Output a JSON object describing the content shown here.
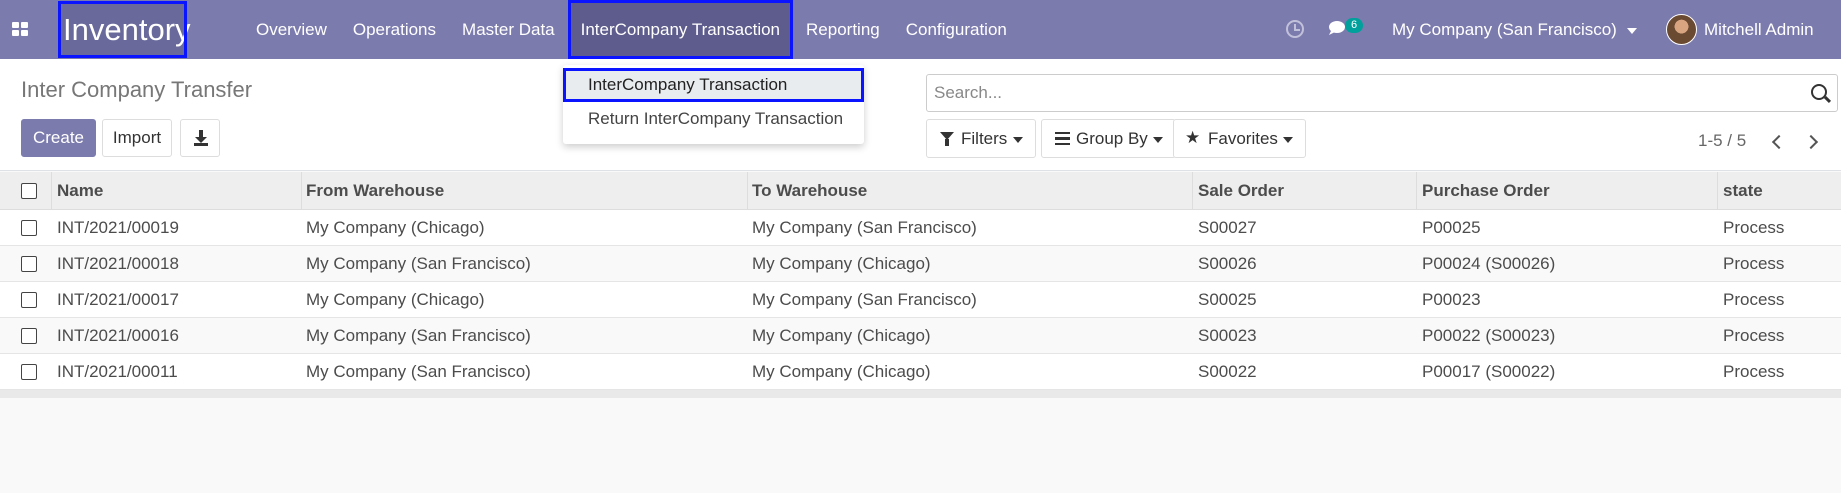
{
  "navbar": {
    "app_title": "Inventory",
    "menu": [
      "Overview",
      "Operations",
      "Master Data",
      "InterCompany Transaction",
      "Reporting",
      "Configuration"
    ],
    "messages_count": "6",
    "company": "My Company (San Francisco)",
    "user": "Mitchell Admin"
  },
  "control": {
    "breadcrumb": "Inter Company Transfer",
    "create_label": "Create",
    "import_label": "Import",
    "search_placeholder": "Search...",
    "filters_label": "Filters",
    "groupby_label": "Group By",
    "favorites_label": "Favorites",
    "pager": "1-5 / 5"
  },
  "dropdown": {
    "items": [
      "InterCompany Transaction",
      "Return InterCompany Transaction"
    ]
  },
  "table": {
    "columns": [
      "Name",
      "From Warehouse",
      "To Warehouse",
      "Sale Order",
      "Purchase Order",
      "state"
    ],
    "rows": [
      [
        "INT/2021/00019",
        "My Company (Chicago)",
        "My Company (San Francisco)",
        "S00027",
        "P00025",
        "Process"
      ],
      [
        "INT/2021/00018",
        "My Company (San Francisco)",
        "My Company (Chicago)",
        "S00026",
        "P00024 (S00026)",
        "Process"
      ],
      [
        "INT/2021/00017",
        "My Company (Chicago)",
        "My Company (San Francisco)",
        "S00025",
        "P00023",
        "Process"
      ],
      [
        "INT/2021/00016",
        "My Company (San Francisco)",
        "My Company (Chicago)",
        "S00023",
        "P00022 (S00023)",
        "Process"
      ],
      [
        "INT/2021/00011",
        "My Company (San Francisco)",
        "My Company (Chicago)",
        "S00022",
        "P00017 (S00022)",
        "Process"
      ]
    ]
  },
  "colors": {
    "navbar": "#7c7bad",
    "highlight_outline": "#0a14ff",
    "badge": "#00a09d"
  }
}
